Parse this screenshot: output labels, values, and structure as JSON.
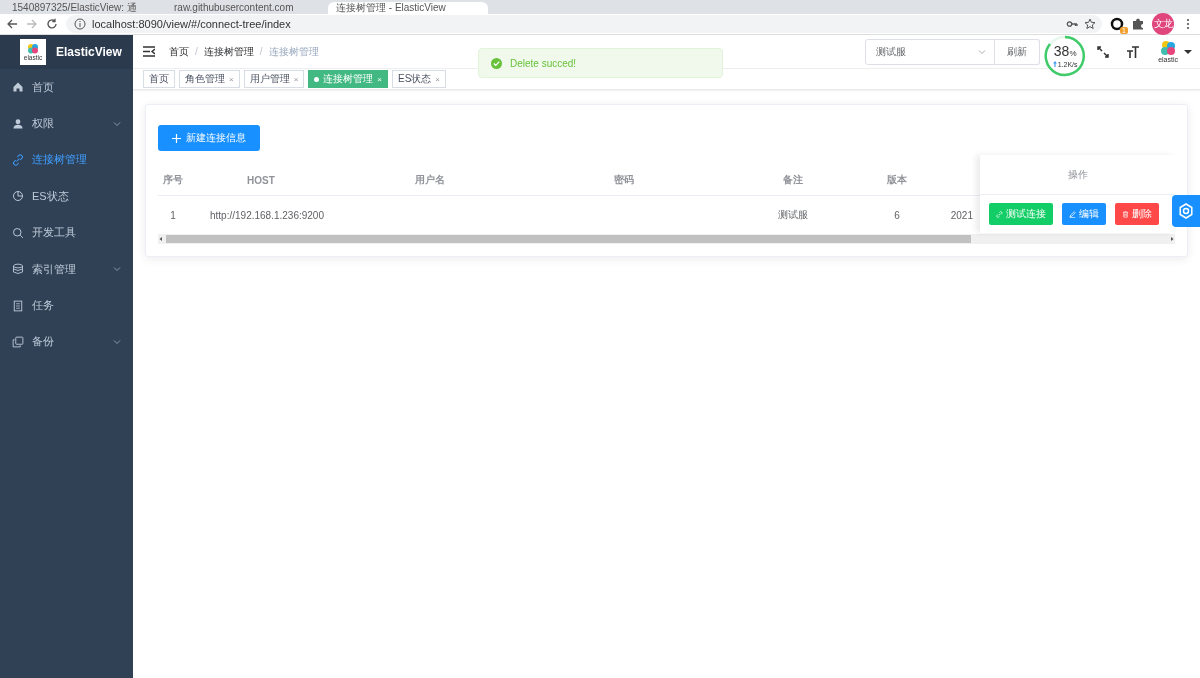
{
  "browser": {
    "tabs": [
      {
        "title": "1540897325/ElasticView: 通",
        "selected": false
      },
      {
        "title": "raw.githubusercontent.com",
        "selected": false
      },
      {
        "title": "连接树管理 - ElasticView",
        "selected": true
      }
    ],
    "address": "localhost:8090/view/#/connect-tree/index",
    "extension_badge": "1",
    "profile": "文龙"
  },
  "sidebar": {
    "title": "ElasticView",
    "logo_caption": "elastic",
    "items": [
      {
        "label": "首页",
        "selected": false,
        "expandable": false
      },
      {
        "label": "权限",
        "selected": false,
        "expandable": true
      },
      {
        "label": "连接树管理",
        "selected": true,
        "expandable": false
      },
      {
        "label": "ES状态",
        "selected": false,
        "expandable": false
      },
      {
        "label": "开发工具",
        "selected": false,
        "expandable": false
      },
      {
        "label": "索引管理",
        "selected": false,
        "expandable": true
      },
      {
        "label": "任务",
        "selected": false,
        "expandable": false
      },
      {
        "label": "备份",
        "selected": false,
        "expandable": true
      }
    ]
  },
  "navbar": {
    "breadcrumb": [
      {
        "label": "首页"
      },
      {
        "separator": "/",
        "label": "连接树管理"
      },
      {
        "separator": "/",
        "label": "连接树管理"
      }
    ],
    "toast": "Delete succed!",
    "cluster_select": {
      "value": "测试服"
    },
    "refresh": "刷新",
    "monitor": {
      "percent": "38",
      "unit": "%",
      "speed": "1.2K/s"
    },
    "avatar_caption": "elastic"
  },
  "tags": [
    {
      "label": "首页",
      "selected": false
    },
    {
      "label": "角色管理",
      "selected": false,
      "close": "×"
    },
    {
      "label": "用户管理",
      "selected": false,
      "close": "×"
    },
    {
      "label": "连接树管理",
      "selected": true,
      "close": "×"
    },
    {
      "label": "ES状态",
      "selected": false,
      "close": "×"
    }
  ],
  "table": {
    "add_button": "新建连接信息",
    "columns": [
      "序号",
      "HOST",
      "用户名",
      "密码",
      "备注",
      "版本"
    ],
    "actions_header": "操作",
    "rows": [
      {
        "cells": [
          "1",
          "http://192.168.1.236:9200",
          "",
          "",
          "测试服",
          "6"
        ],
        "column_7": "2021",
        "actions": [
          {
            "kind": "test",
            "label": "测试连接"
          },
          {
            "kind": "edit",
            "label": "编辑"
          },
          {
            "kind": "delete",
            "label": "删除"
          }
        ]
      }
    ]
  }
}
